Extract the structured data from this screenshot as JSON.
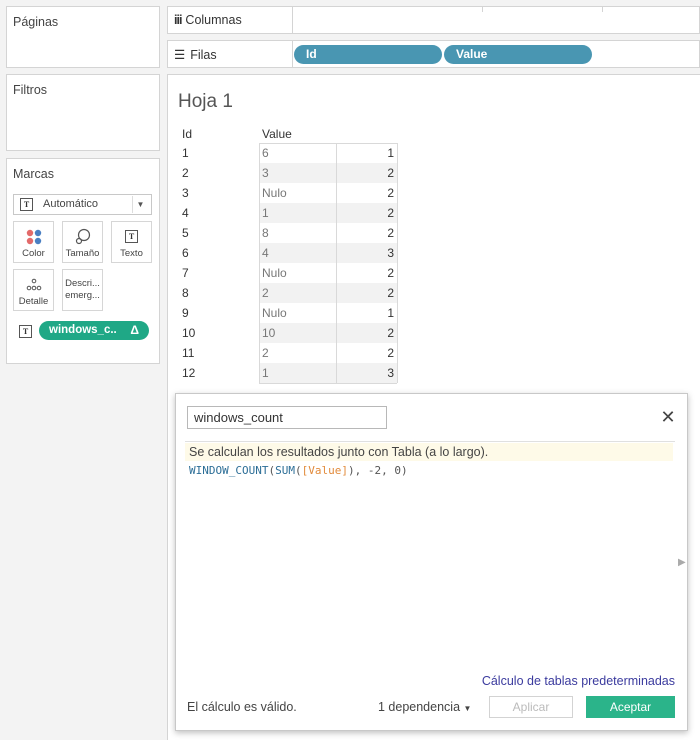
{
  "left": {
    "pages_title": "Páginas",
    "filters_title": "Filtros",
    "marks_title": "Marcas",
    "marks_type": "Automático",
    "mark_buttons": {
      "color": "Color",
      "size": "Tamaño",
      "text": "Texto",
      "detail": "Detalle",
      "tooltip_line1": "Descri...",
      "tooltip_line2": "emerg..."
    },
    "field_pill": "windows_c..",
    "field_pill_badge": "Δ"
  },
  "shelves": {
    "columns_label": "Columnas",
    "rows_label": "Filas",
    "row_pills": [
      "Id",
      "Value"
    ]
  },
  "sheet": {
    "title": "Hoja 1",
    "headers": [
      "Id",
      "Value"
    ],
    "rows": [
      {
        "id": "1",
        "value": "6",
        "count": "1"
      },
      {
        "id": "2",
        "value": "3",
        "count": "2"
      },
      {
        "id": "3",
        "value": "Nulo",
        "count": "2"
      },
      {
        "id": "4",
        "value": "1",
        "count": "2"
      },
      {
        "id": "5",
        "value": "8",
        "count": "2"
      },
      {
        "id": "6",
        "value": "4",
        "count": "3"
      },
      {
        "id": "7",
        "value": "Nulo",
        "count": "2"
      },
      {
        "id": "8",
        "value": "2",
        "count": "2"
      },
      {
        "id": "9",
        "value": "Nulo",
        "count": "1"
      },
      {
        "id": "10",
        "value": "10",
        "count": "2"
      },
      {
        "id": "11",
        "value": "2",
        "count": "2"
      },
      {
        "id": "12",
        "value": "1",
        "count": "3"
      }
    ]
  },
  "dialog": {
    "calc_name": "windows_count",
    "note": "Se calculan los resultados junto con Tabla (a lo largo).",
    "formula_fn": "WINDOW_COUNT",
    "formula_open": "(",
    "formula_sum": "SUM",
    "formula_open2": "(",
    "formula_field": "[Value]",
    "formula_rest": "), -2, 0)",
    "default_link": "Cálculo de tablas predeterminadas",
    "status": "El cálculo es válido.",
    "dependency": "1 dependencia",
    "apply": "Aplicar",
    "accept": "Aceptar"
  },
  "colors": {
    "blue_pill": "#4996b2",
    "green_pill": "#1fa886",
    "accept": "#2bb48a",
    "link": "#3b3b9e"
  }
}
